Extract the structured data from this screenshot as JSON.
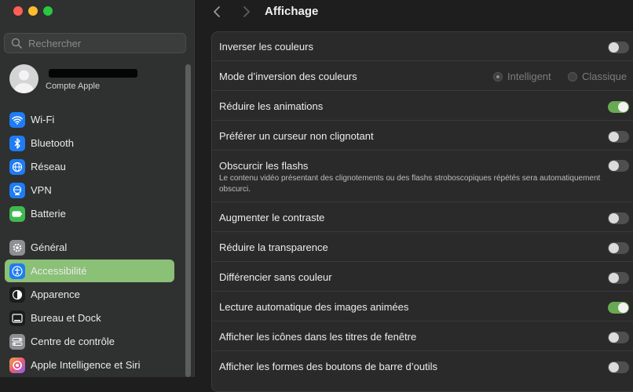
{
  "sidebar": {
    "search": {
      "placeholder": "Rechercher"
    },
    "account": {
      "subtitle": "Compte Apple"
    },
    "items": [
      {
        "label": "Wi-Fi",
        "icon": "wifi-icon",
        "color": "#1e7cf5"
      },
      {
        "label": "Bluetooth",
        "icon": "bluetooth-icon",
        "color": "#1e7cf5"
      },
      {
        "label": "Réseau",
        "icon": "globe-icon",
        "color": "#1e7cf5"
      },
      {
        "label": "VPN",
        "icon": "vpn-globe-icon",
        "color": "#1e7cf5"
      },
      {
        "label": "Batterie",
        "icon": "battery-icon",
        "color": "#3fb950"
      },
      {
        "label": "Général",
        "icon": "gear-icon",
        "color": "#8e8e93"
      },
      {
        "label": "Accessibilité",
        "icon": "accessibility-icon",
        "color": "#1e7cf5"
      },
      {
        "label": "Apparence",
        "icon": "appearance-icon",
        "color": "#1c1c1c"
      },
      {
        "label": "Bureau et Dock",
        "icon": "dock-icon",
        "color": "#1c1c1c"
      },
      {
        "label": "Centre de contrôle",
        "icon": "control-center-icon",
        "color": "#8e8e93"
      },
      {
        "label": "Apple Intelligence et Siri",
        "icon": "siri-icon",
        "color": "#e85b7a"
      }
    ]
  },
  "main": {
    "title": "Affichage",
    "rows": [
      {
        "label": "Inverser les couleurs",
        "on": false
      },
      {
        "label": "Mode d’inversion des couleurs",
        "options": [
          "Intelligent",
          "Classique"
        ],
        "selected": "Intelligent"
      },
      {
        "label": "Réduire les animations",
        "on": true
      },
      {
        "label": "Préférer un curseur non clignotant",
        "on": false
      },
      {
        "label": "Obscurcir les flashs",
        "on": false,
        "description": "Le contenu vidéo présentant des clignotements ou des flashs stroboscopiques répétés sera automatiquement obscurci."
      },
      {
        "label": "Augmenter le contraste",
        "on": false
      },
      {
        "label": "Réduire la transparence",
        "on": false
      },
      {
        "label": "Différencier sans couleur",
        "on": false
      },
      {
        "label": "Lecture automatique des images animées",
        "on": true
      },
      {
        "label": "Afficher les icônes dans les titres de fenêtre",
        "on": false
      },
      {
        "label": "Afficher les formes des boutons de barre d’outils",
        "on": false
      }
    ]
  },
  "colors": {
    "accent": "#8bc077",
    "toggle_on": "#6aa954"
  }
}
